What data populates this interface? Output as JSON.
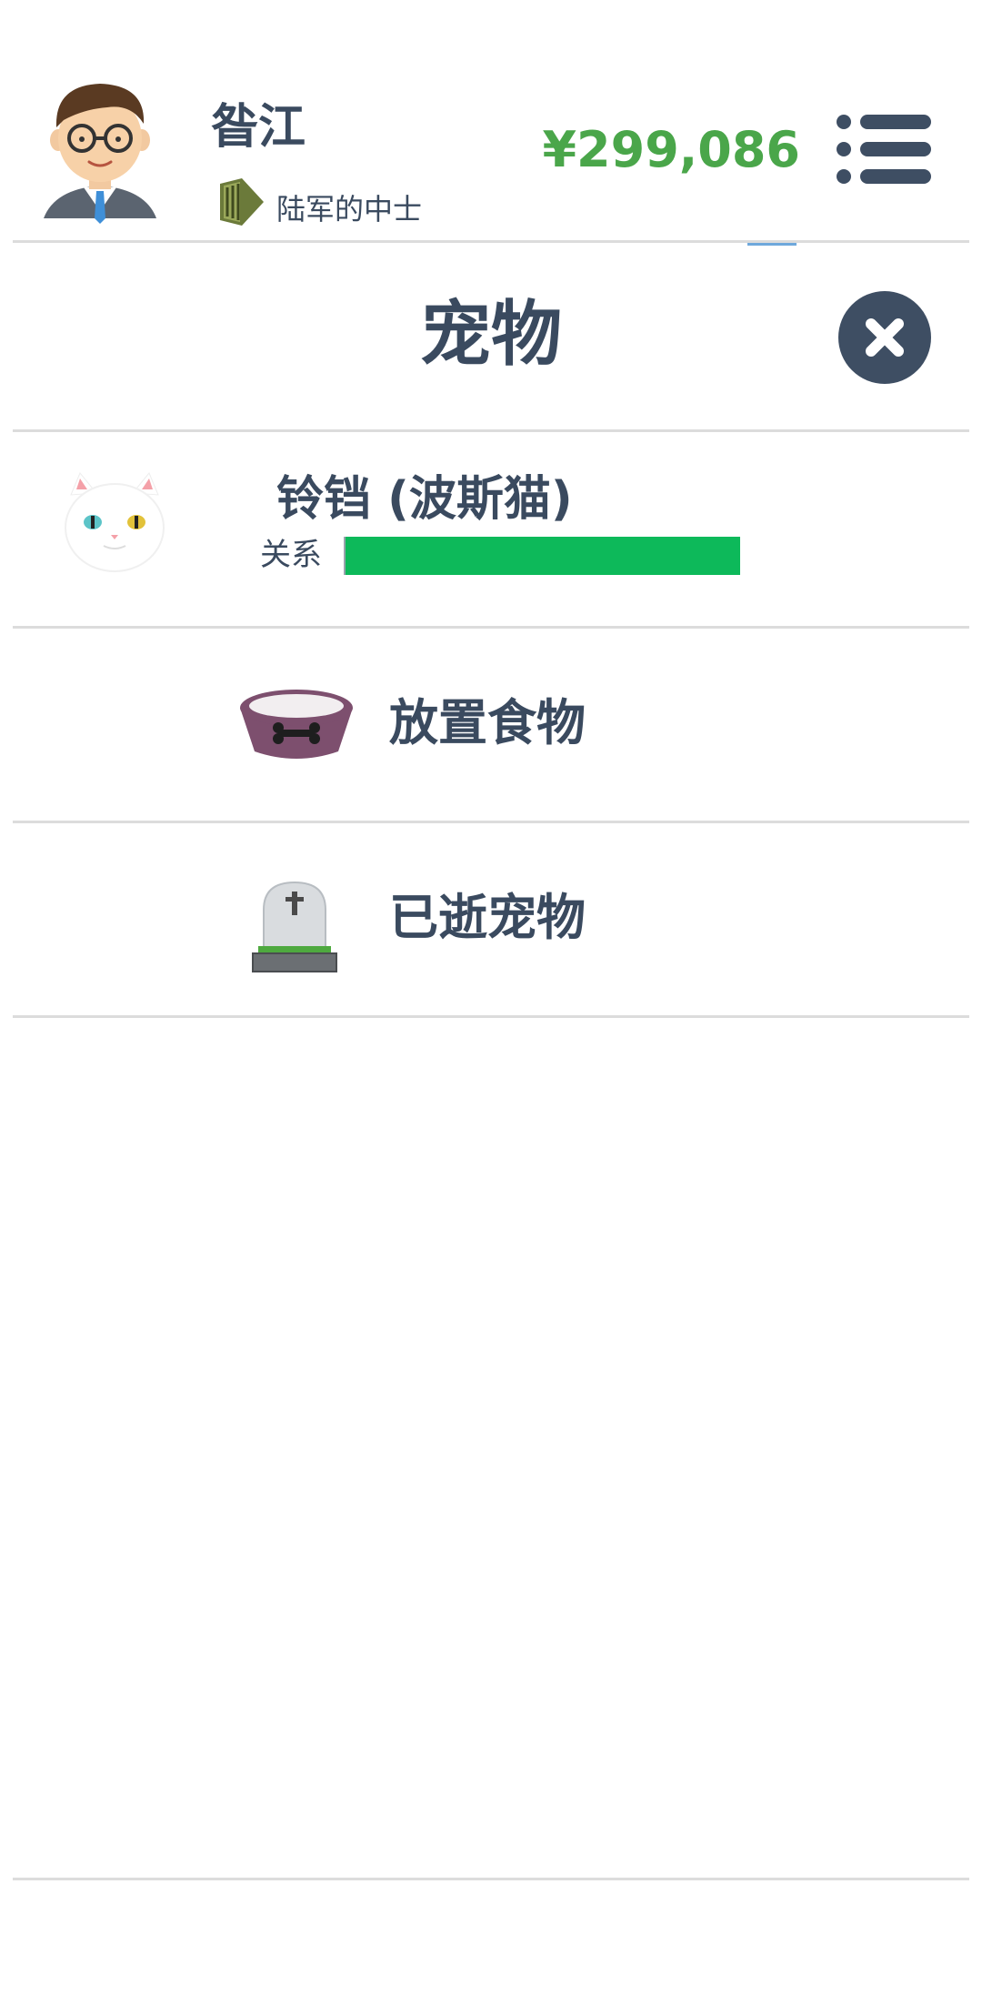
{
  "header": {
    "player_name": "昝江",
    "rank": "陆军的中士",
    "money": "¥299,086",
    "icons": {
      "avatar": "businessman-avatar",
      "rank": "army-rank-icon",
      "menu": "menu-icon"
    }
  },
  "panel": {
    "title": "宠物",
    "close_icon": "close-icon"
  },
  "pet": {
    "name": "铃铛 (波斯猫)",
    "relation_label": "关系",
    "relation_level": 1.0,
    "icon": "persian-cat-icon"
  },
  "actions": [
    {
      "label": "放置食物",
      "icon": "pet-food-bowl-icon"
    },
    {
      "label": "已逝宠物",
      "icon": "tombstone-icon"
    }
  ],
  "colors": {
    "text": "#3a4a5f",
    "money": "#4aa64a",
    "relation_bar": "#0db95a",
    "close_button": "#3e4e63",
    "divider": "#dcdcdc",
    "food_bowl": "#7d4f6e"
  }
}
